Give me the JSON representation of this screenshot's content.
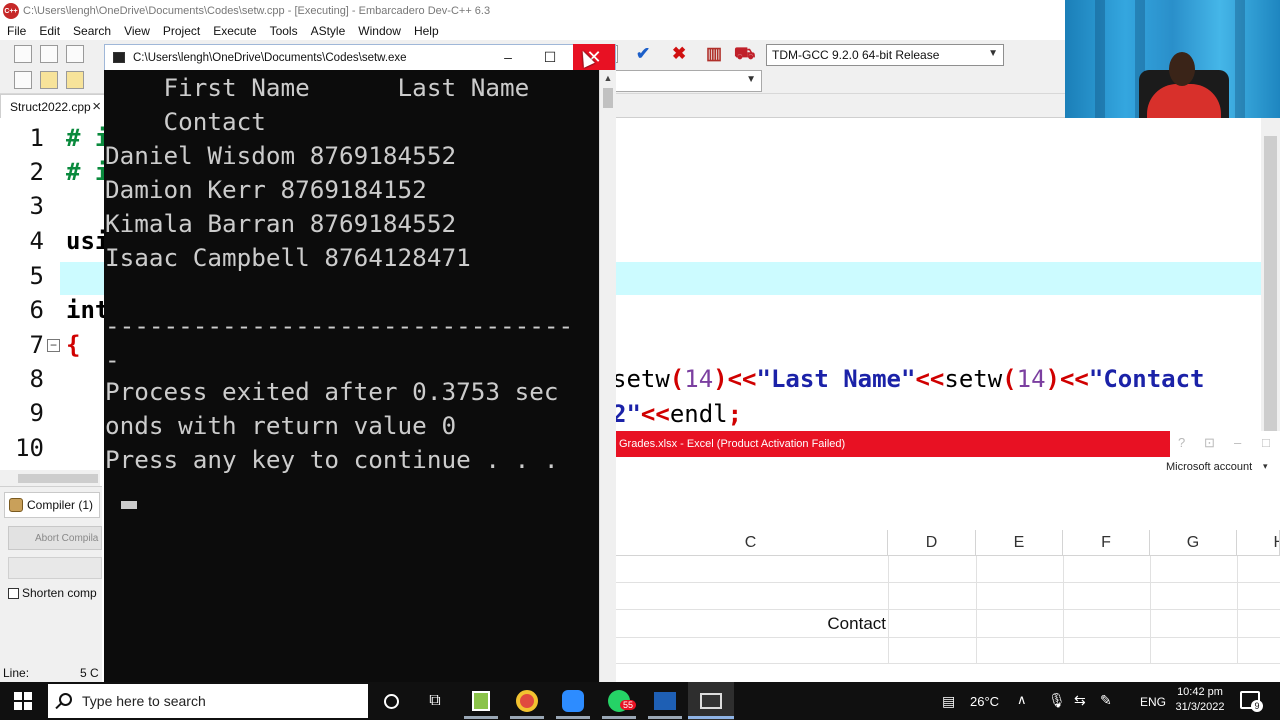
{
  "ide": {
    "title": "C:\\Users\\lengh\\OneDrive\\Documents\\Codes\\setw.cpp - [Executing] - Embarcadero Dev-C++ 6.3",
    "menu": [
      "File",
      "Edit",
      "Search",
      "View",
      "Project",
      "Execute",
      "Tools",
      "AStyle",
      "Window",
      "Help"
    ],
    "compiler_select": "TDM-GCC 9.2.0 64-bit Release",
    "file_tab": "Struct2022.cpp",
    "line_numbers": [
      "1",
      "2",
      "3",
      "4",
      "5",
      "6",
      "7",
      "8",
      "9",
      "10"
    ],
    "code": {
      "l1": "# i",
      "l2": "# i",
      "l4": "usi",
      "l6": "int",
      "l7": "{",
      "l8": {
        "fn1": "setw",
        "n1": "14",
        "s1": "\"Last Name\"",
        "fn2": "setw",
        "n2": "14",
        "s2": "\"Contact"
      },
      "l9": {
        "s": "2\"",
        "kw": "endl"
      }
    },
    "bottom": {
      "compiler_tab": "Compiler (1)",
      "abort_button": "Abort Compila",
      "shorten_label": "Shorten comp"
    },
    "status": {
      "line_label": "Line:",
      "col_value": "5 C"
    }
  },
  "console": {
    "title": "C:\\Users\\lengh\\OneDrive\\Documents\\Codes\\setw.exe",
    "lines": [
      "    First Name      Last Name",
      "    Contact",
      "Daniel Wisdom 8769184552",
      "Damion Kerr 8769184152",
      "Kimala Barran 8769184552",
      "Isaac Campbell 8764128471",
      "",
      "--------------------------------",
      "-",
      "Process exited after 0.3753 sec",
      "onds with return value 0",
      "Press any key to continue . . ."
    ]
  },
  "excel": {
    "title": "Grades.xlsx  -  Excel (Product Activation Failed)",
    "title_controls": [
      "?",
      "⊡",
      "–",
      "□"
    ],
    "account": "Microsoft account",
    "columns": [
      "C",
      "D",
      "E",
      "F",
      "G",
      "H"
    ],
    "cell_contact": "Contact"
  },
  "taskbar": {
    "search_placeholder": "Type here to search",
    "weather": "26°C",
    "language": "ENG",
    "time": "10:42 pm",
    "date": "31/3/2022",
    "notification_count": "9",
    "whatsapp_badge": "55"
  },
  "colors": {
    "console_bg": "#0c0c0c",
    "console_fg": "#cccccc",
    "excel_red": "#e81123",
    "highlight_line": "#ccfbff",
    "string_blue": "#1b22a8",
    "operator_red": "#d00000"
  }
}
